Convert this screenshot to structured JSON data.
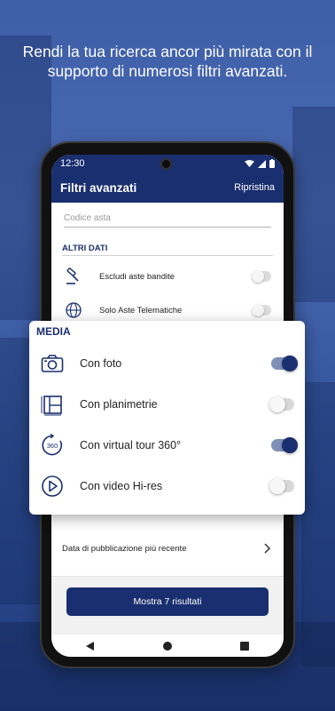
{
  "headline": "Rendi la tua ricerca ancor più mirata con il supporto di numerosi filtri avanzati.",
  "status_bar": {
    "time": "12:30"
  },
  "app_bar": {
    "title": "Filtri avanzati",
    "reset_label": "Ripristina"
  },
  "search_field": {
    "placeholder": "Codice asta"
  },
  "altri_dati": {
    "section_title": "ALTRI DATI",
    "items": [
      {
        "label": "Escludi aste bandite",
        "icon": "gavel-icon",
        "enabled": false
      },
      {
        "label": "Solo Aste Telematiche",
        "icon": "globe-icon",
        "enabled": false
      }
    ]
  },
  "media": {
    "section_title": "MEDIA",
    "items": [
      {
        "label": "Con foto",
        "icon": "camera-icon",
        "enabled": true
      },
      {
        "label": "Con planimetrie",
        "icon": "floorplan-icon",
        "enabled": false
      },
      {
        "label": "Con virtual tour 360°",
        "icon": "tour-360-icon",
        "enabled": true
      },
      {
        "label": "Con video Hi-res",
        "icon": "play-icon",
        "enabled": false
      }
    ]
  },
  "sort_row": {
    "label": "Data di pubblicazione più recente"
  },
  "cta": {
    "label": "Mostra 7 risultati"
  },
  "colors": {
    "primary": "#1a2f6f",
    "background": "#3e5ea8"
  }
}
